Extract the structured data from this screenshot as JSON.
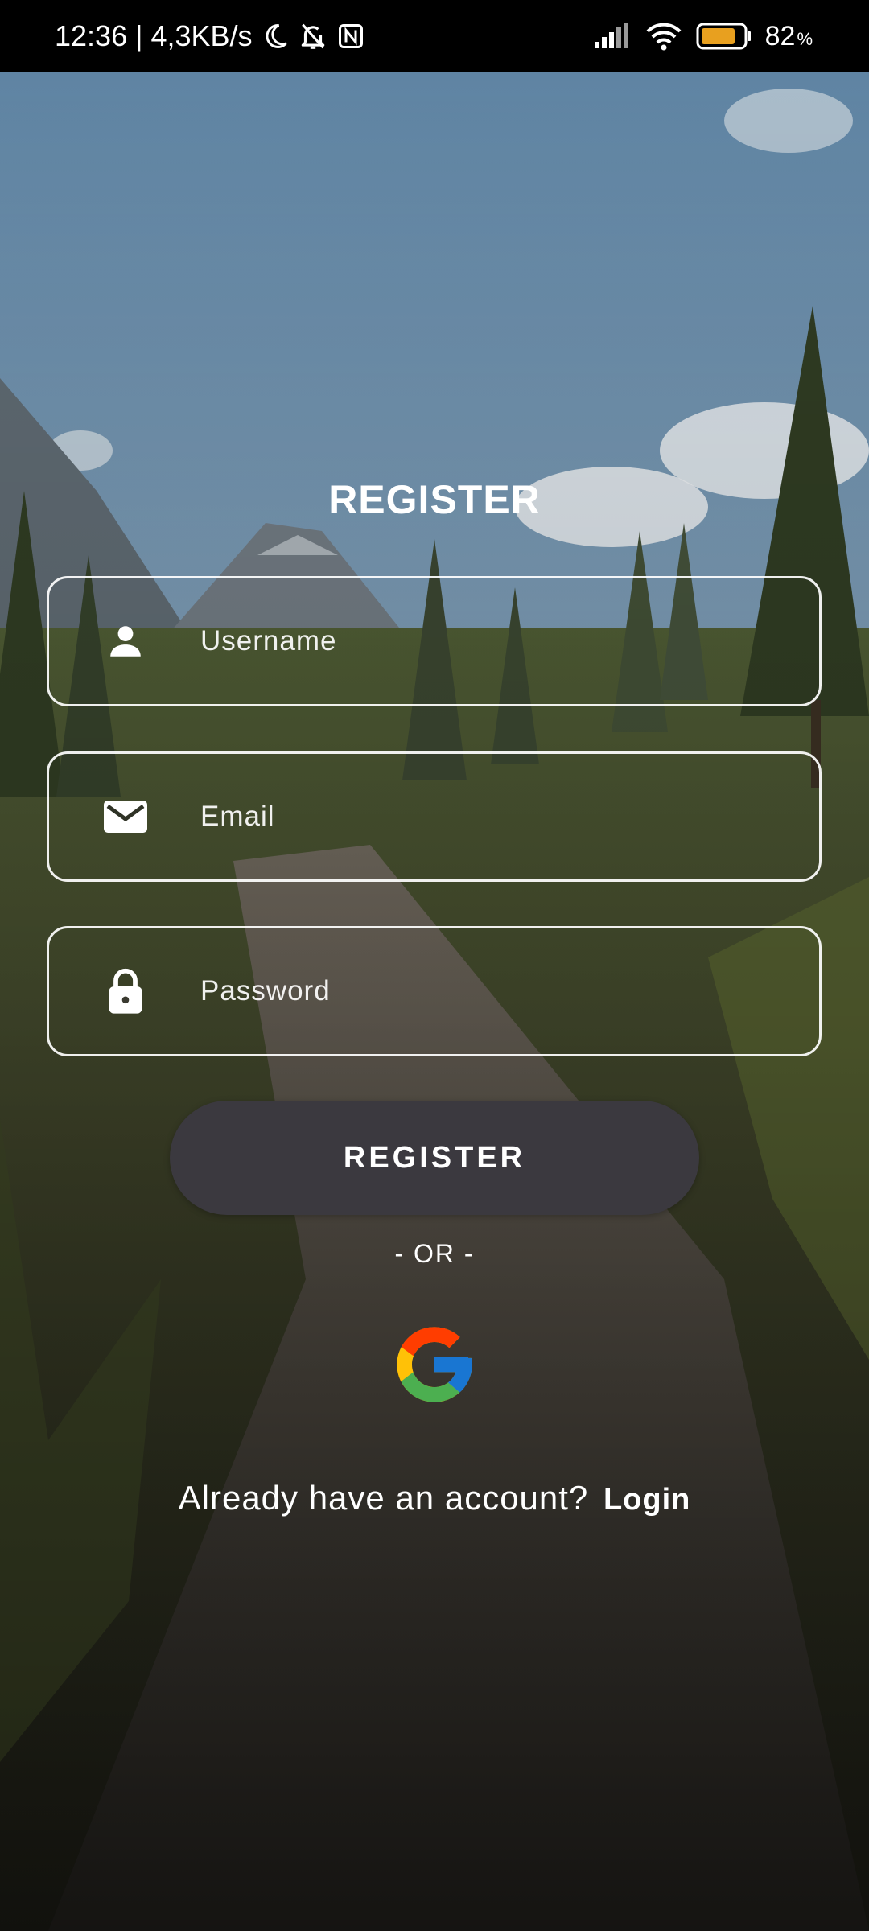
{
  "status_bar": {
    "time_speed": "12:36 | 4,3KB/s",
    "battery_percent": "82",
    "battery_symbol": "%",
    "battery_level": 0.82,
    "icons": [
      "moon-icon",
      "bell-off-icon",
      "nfc-icon",
      "signal-icon",
      "wifi-icon",
      "battery-icon"
    ]
  },
  "form": {
    "title": "REGISTER",
    "username_placeholder": "Username",
    "email_placeholder": "Email",
    "password_placeholder": "Password",
    "submit_label": "REGISTER",
    "divider_text": "- OR -",
    "google_icon": "google-icon"
  },
  "footer": {
    "prompt": "Already have an account?",
    "login_label": "Login"
  },
  "colors": {
    "field_border": "#ffffff",
    "button_bg": "#3b393f",
    "battery_fill": "#e8a01f",
    "google_blue": "#4285F4",
    "google_red": "#EA4335",
    "google_yellow": "#FBBC05",
    "google_green": "#34A853"
  }
}
